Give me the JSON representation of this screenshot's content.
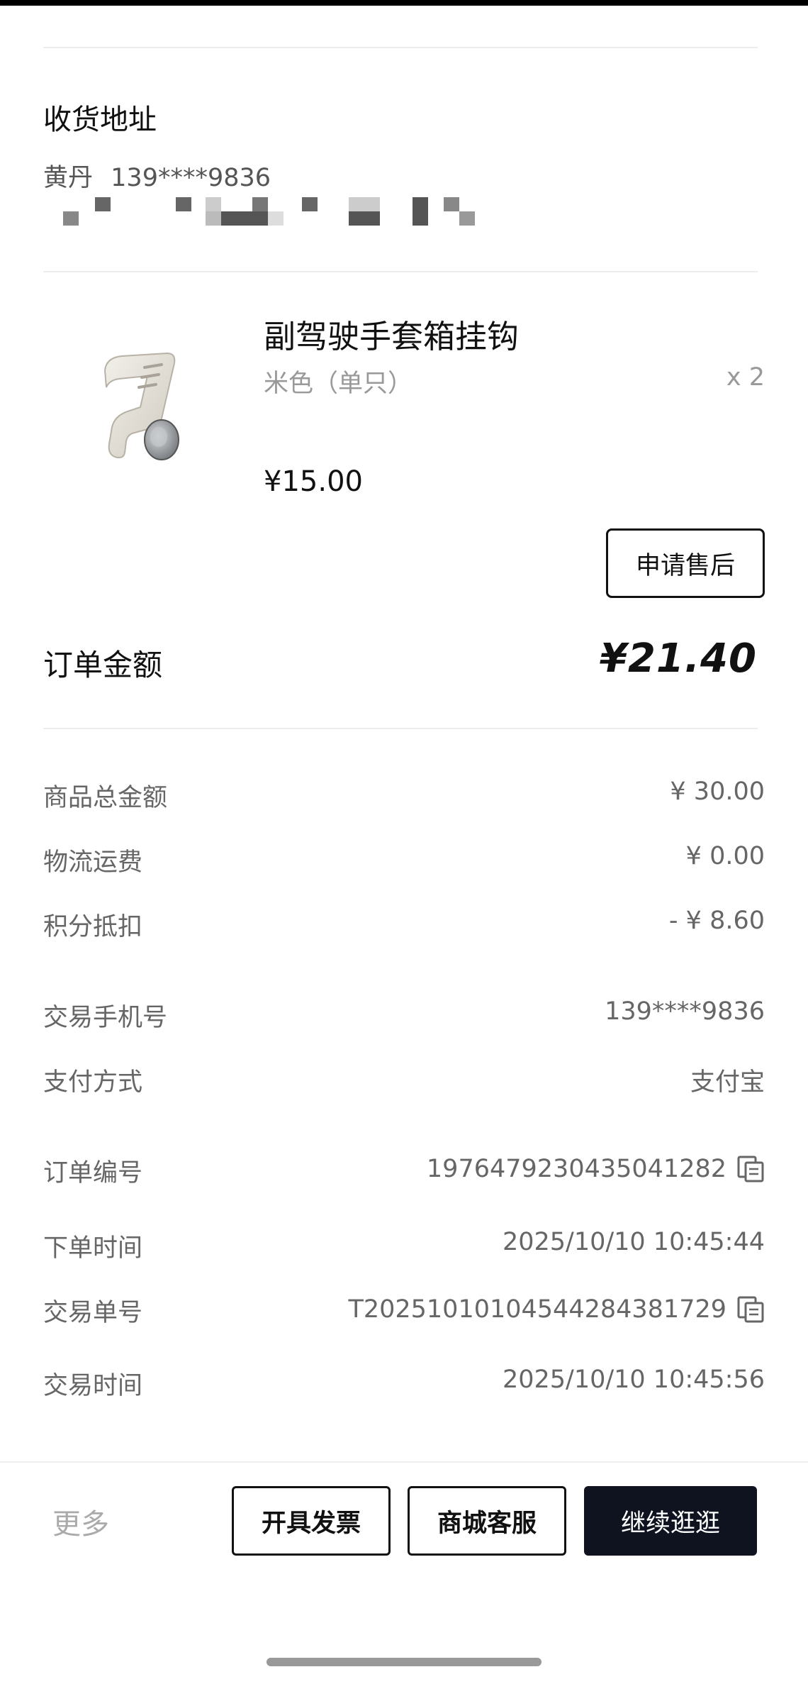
{
  "address": {
    "title": "收货地址",
    "recipient": "黄丹",
    "phone": "139****9836"
  },
  "product": {
    "title": "副驾驶手套箱挂钩",
    "spec": "米色（单只）",
    "quantity": "x 2",
    "price": "¥15.00",
    "after_sale_label": "申请售后",
    "image_icon": "hook-product-image"
  },
  "order_total": {
    "label": "订单金额",
    "value": "¥21.40"
  },
  "fees": [
    {
      "label": "商品总金额",
      "value": "¥ 30.00"
    },
    {
      "label": "物流运费",
      "value": "¥ 0.00"
    },
    {
      "label": "积分抵扣",
      "value": "- ¥ 8.60"
    }
  ],
  "payment": [
    {
      "label": "交易手机号",
      "value": "139****9836"
    },
    {
      "label": "支付方式",
      "value": "支付宝"
    }
  ],
  "order_info": [
    {
      "label": "订单编号",
      "value": "1976479230435041282",
      "copyable": true
    },
    {
      "label": "下单时间",
      "value": "2025/10/10 10:45:44",
      "copyable": false
    },
    {
      "label": "交易单号",
      "value": "T2025101010454428438172​9",
      "copyable": true
    },
    {
      "label": "交易时间",
      "value": "2025/10/10 10:45:56",
      "copyable": false
    }
  ],
  "bottom_bar": {
    "more_label": "更多",
    "invoice_label": "开具发票",
    "service_label": "商城客服",
    "continue_label": "继续逛逛"
  },
  "colors": {
    "primary_button_bg": "#0f1320",
    "divider": "#ececec",
    "muted_text": "#666666"
  }
}
